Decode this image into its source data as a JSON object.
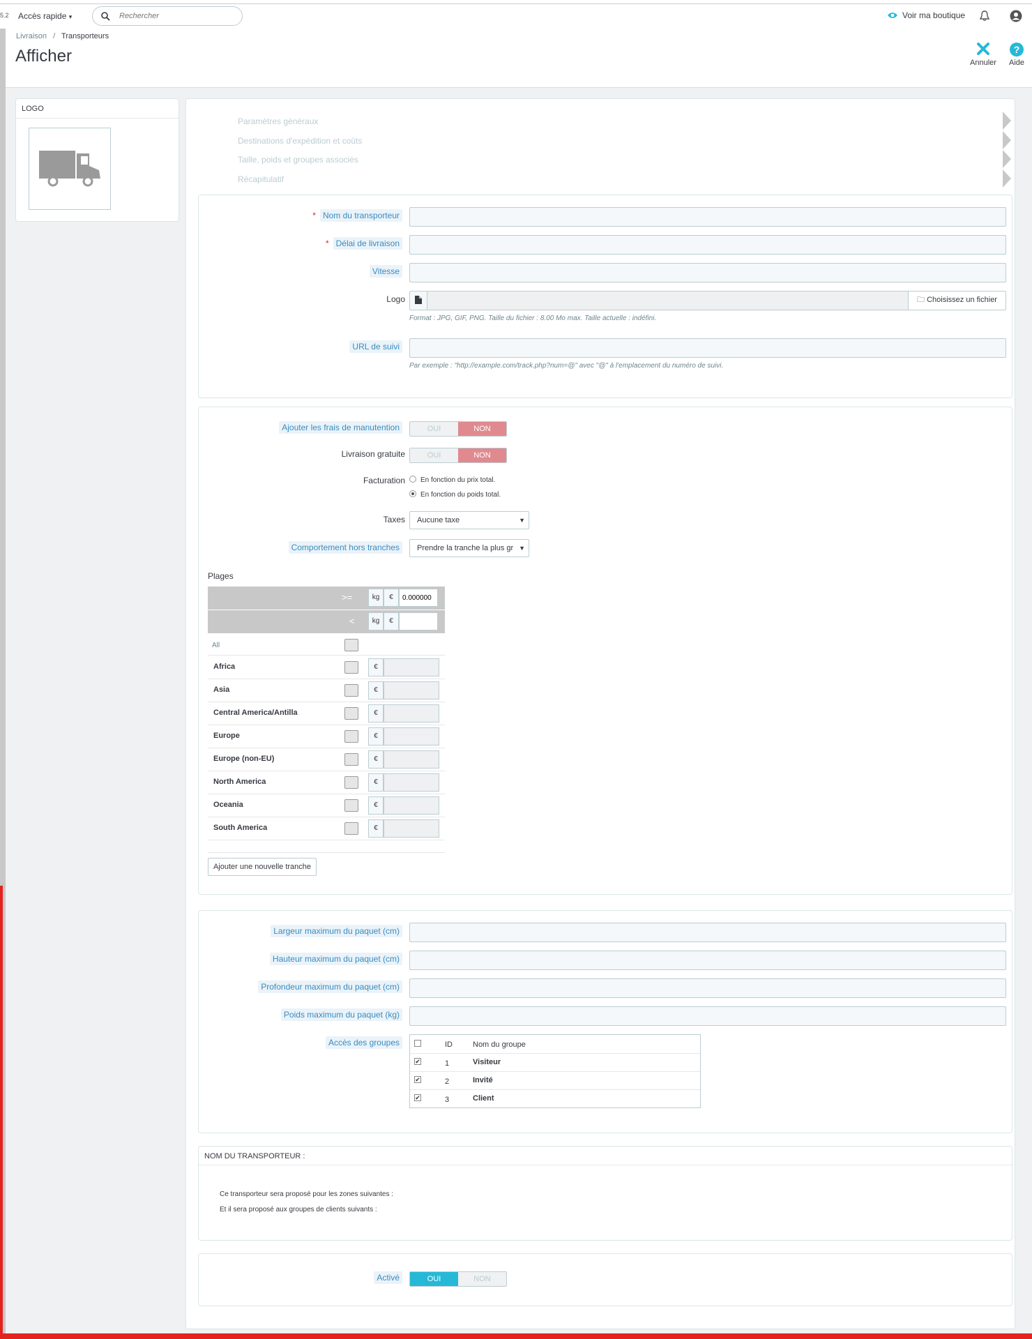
{
  "topbar": {
    "version_fragment": "5.2",
    "quick_access": "Accès rapide",
    "search_placeholder": "Rechercher",
    "view_shop": "Voir ma boutique"
  },
  "header": {
    "breadcrumb_parent": "Livraison",
    "breadcrumb_sep": "/",
    "breadcrumb_current": "Transporteurs",
    "title": "Afficher",
    "cancel_label": "Annuler",
    "help_label": "Aide"
  },
  "logo_panel": {
    "heading": "LOGO"
  },
  "wizard": {
    "steps": [
      "Paramètres généraux",
      "Destinations d'expédition et coûts",
      "Taille, poids et groupes associés",
      "Récapitulatif"
    ]
  },
  "general": {
    "carrier_name_label": "Nom du transporteur",
    "delay_label": "Délai de livraison",
    "speed_label": "Vitesse",
    "logo_label": "Logo",
    "choose_file": "Choisissez un fichier",
    "logo_help": "Format : JPG, GIF, PNG. Taille du fichier : 8.00 Mo max. Taille actuelle : indéfini.",
    "tracking_label": "URL de suivi",
    "tracking_help": "Par exemple : \"http://example.com/track.php?num=@\" avec \"@\" à l'emplacement du numéro de suivi."
  },
  "shipping": {
    "handling_label": "Ajouter les frais de manutention",
    "free_label": "Livraison gratuite",
    "yes": "OUI",
    "no": "NON",
    "billing_label": "Facturation",
    "billing_price": "En fonction du prix total.",
    "billing_weight": "En fonction du poids total.",
    "taxes_label": "Taxes",
    "taxes_value": "Aucune taxe",
    "out_of_range_label": "Comportement hors tranches",
    "out_of_range_value": "Prendre la tranche la plus gr",
    "ranges_heading": "Plages",
    "range_ge": ">=",
    "range_lt": "<",
    "unit_kg": "kg",
    "currency": "€",
    "range_from_value": "0.000000",
    "all_label": "All",
    "zones": [
      "Africa",
      "Asia",
      "Central America/Antilla",
      "Europe",
      "Europe (non-EU)",
      "North America",
      "Oceania",
      "South America"
    ],
    "add_range": "Ajouter une nouvelle tranche"
  },
  "package": {
    "width_label": "Largeur maximum du paquet (cm)",
    "height_label": "Hauteur maximum du paquet (cm)",
    "depth_label": "Profondeur maximum du paquet (cm)",
    "weight_label": "Poids maximum du paquet (kg)",
    "groups_label": "Accès des groupes",
    "groups_header_id": "ID",
    "groups_header_name": "Nom du groupe",
    "groups": [
      {
        "id": "1",
        "name": "Visiteur"
      },
      {
        "id": "2",
        "name": "Invité"
      },
      {
        "id": "3",
        "name": "Client"
      }
    ]
  },
  "summary": {
    "heading": "NOM DU TRANSPORTEUR :",
    "line1": "Ce transporteur sera proposé pour les zones suivantes :",
    "line2": "Et il sera proposé aux groupes de clients suivants :"
  },
  "status": {
    "active_label": "Activé",
    "yes": "OUI",
    "no": "NON"
  },
  "colors": {
    "accent": "#25b9d7",
    "danger": "#e08a8f",
    "required": "#e42320"
  }
}
